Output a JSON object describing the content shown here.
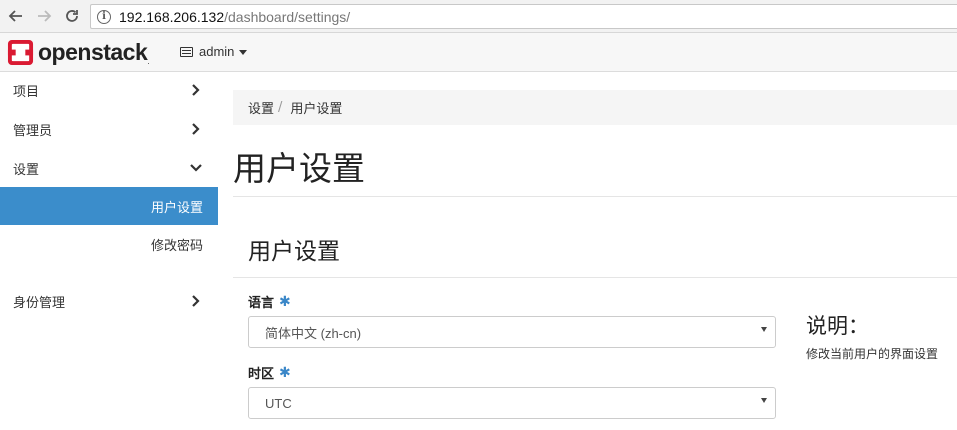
{
  "browser": {
    "url_host": "192.168.206.132",
    "url_path": "/dashboard/settings/"
  },
  "navbar": {
    "logo_text": "openstack",
    "logo_reg": ".",
    "project": "admin"
  },
  "sidebar": {
    "items": [
      {
        "label": "项目",
        "chevron": "right"
      },
      {
        "label": "管理员",
        "chevron": "right"
      },
      {
        "label": "设置",
        "chevron": "down"
      },
      {
        "label": "身份管理",
        "chevron": "right"
      }
    ],
    "sub_items": [
      {
        "label": "用户设置",
        "active": true
      },
      {
        "label": "修改密码",
        "active": false
      }
    ]
  },
  "breadcrumb": {
    "parent": "设置",
    "separator": "/",
    "current": "用户设置"
  },
  "page": {
    "title": "用户设置",
    "section_title": "用户设置"
  },
  "form": {
    "language_label": "语言",
    "language_value": "简体中文 (zh-cn)",
    "timezone_label": "时区",
    "timezone_value": "UTC",
    "required_mark": "✱"
  },
  "help": {
    "title": "说明：",
    "text": "修改当前用户的界面设置"
  },
  "colors": {
    "active_sidebar": "#3b8dcb",
    "required": "#3a87c8",
    "logo_red": "#da1a32"
  }
}
